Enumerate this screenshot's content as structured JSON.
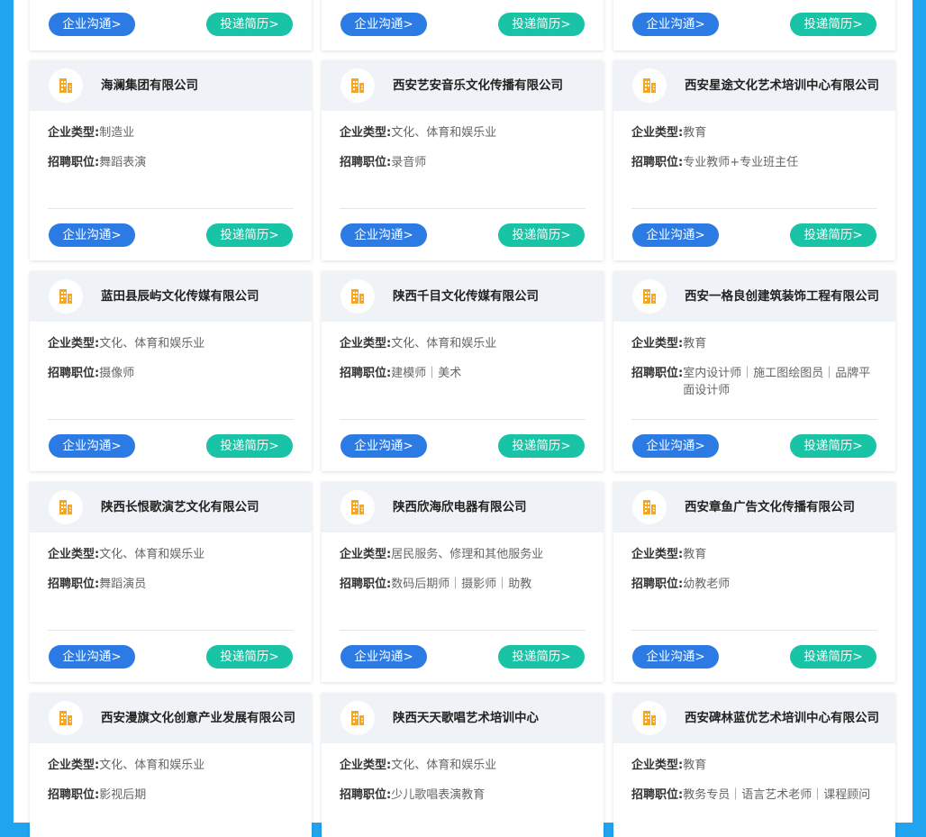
{
  "buttons": {
    "chat": "企业沟通>",
    "resume": "投递简历>"
  },
  "labels": {
    "type": "企业类型:",
    "position": "招聘职位:"
  },
  "colors": {
    "background_side": "#20a4f0",
    "chat_button": "#2c7be5",
    "resume_button": "#19c3a5",
    "logo_icon": "#f5a623"
  },
  "icons": {
    "company_logo": "building-icon"
  },
  "cards": [
    {
      "name": "海澜集团有限公司",
      "type": "制造业",
      "positions": "舞蹈表演"
    },
    {
      "name": "西安艺安音乐文化传播有限公司",
      "type": "文化、体育和娱乐业",
      "positions": "录音师"
    },
    {
      "name": "西安星途文化艺术培训中心有限公司",
      "type": "教育",
      "positions": "专业教师+专业班主任"
    },
    {
      "name": "蓝田县辰屿文化传媒有限公司",
      "type": "文化、体育和娱乐业",
      "positions": "摄像师"
    },
    {
      "name": "陕西千目文化传媒有限公司",
      "type": "文化、体育和娱乐业",
      "positions": "建模师｜美术"
    },
    {
      "name": "西安一格良创建筑装饰工程有限公司",
      "type": "教育",
      "positions": "室内设计师｜施工图绘图员｜品牌平面设计师"
    },
    {
      "name": "陕西长恨歌演艺文化有限公司",
      "type": "文化、体育和娱乐业",
      "positions": "舞蹈演员"
    },
    {
      "name": "陕西欣海欣电器有限公司",
      "type": "居民服务、修理和其他服务业",
      "positions": "数码后期师｜摄影师｜助教"
    },
    {
      "name": "西安章鱼广告文化传播有限公司",
      "type": "教育",
      "positions": "幼教老师"
    },
    {
      "name": "西安漫旗文化创意产业发展有限公司",
      "type": "文化、体育和娱乐业",
      "positions": "影视后期"
    },
    {
      "name": "陕西天天歌唱艺术培训中心",
      "type": "文化、体育和娱乐业",
      "positions": "少儿歌唱表演教育"
    },
    {
      "name": "西安碑林蓝优艺术培训中心有限公司",
      "type": "教育",
      "positions": "教务专员｜语言艺术老师｜课程顾问"
    }
  ]
}
